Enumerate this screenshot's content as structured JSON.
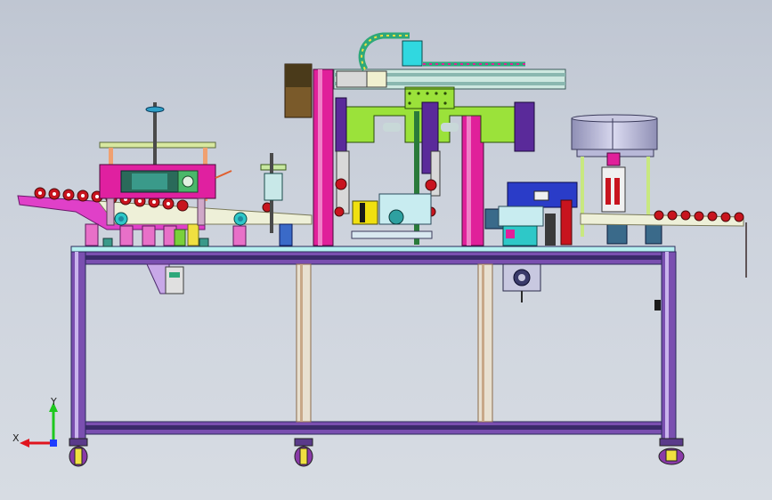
{
  "view": {
    "background_top": "#bfc6d2",
    "background_bottom": "#d7dce3",
    "triad": {
      "x_label": "X",
      "y_label": "Y",
      "x_color": "#e0141e",
      "y_color": "#1ec81e",
      "z_color": "#1e3cff"
    }
  },
  "colors": {
    "frame_purple": "#7a4fb0",
    "frame_dark": "#3a2a6a",
    "gantry_green": "#9be23a",
    "column_magenta": "#e0209a",
    "conveyor_pink": "#e040c8",
    "roller_red": "#c8141e",
    "drum_gray": "#a9a9c7",
    "base_cyan": "#2ec8c8",
    "plate_cream": "#eef0d8",
    "block_blue": "#2a3cc8",
    "block_yellow": "#f0e010",
    "drag_chain": "#2ea87a"
  },
  "parts": [
    "machine-frame",
    "gantry-arm",
    "lifting-column",
    "feed-conveyor",
    "output-conveyor",
    "vibratory-bowl",
    "cylinder-station",
    "drag-chain",
    "caster-wheel"
  ]
}
